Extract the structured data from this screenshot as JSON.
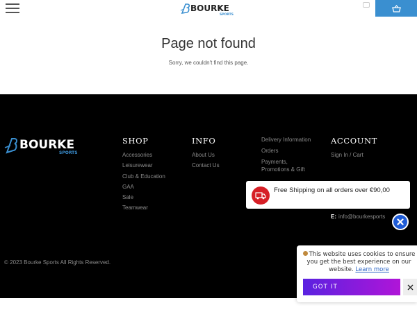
{
  "header": {
    "logo_alt": "BOURKE SPORTS",
    "menu_icon": "hamburger-icon",
    "basket_icon": "basket-icon"
  },
  "not_found": {
    "title": "Page not found",
    "message": "Sorry, we couldn't find this page."
  },
  "footer": {
    "brand": "BOURKE",
    "brand_sub": "SPORTS",
    "shop": {
      "heading": "SHOP",
      "links": [
        "Accessories",
        "Leisurewear",
        "Club & Education",
        "GAA",
        "Sale",
        "Teamwear"
      ]
    },
    "info": {
      "heading": "INFO",
      "links": [
        "About Us",
        "Contact Us"
      ]
    },
    "more": {
      "links": [
        "Delivery Information",
        "Orders",
        "Payments, Promotions & Gift"
      ]
    },
    "account": {
      "heading": "ACCOUNT",
      "links": [
        "Sign In / Cart"
      ]
    },
    "email_label": "E:",
    "email_value": "info@bourkesports",
    "copyright": "© 2023 Bourke Sports All Rights Reserved."
  },
  "shipping_popup": {
    "text": "Free Shipping on all orders over €90,00",
    "icon": "truck-icon",
    "close_icon": "close-icon"
  },
  "cookie_banner": {
    "text": "This website uses cookies to ensure you get the best experience on our website.",
    "learn_more": "Learn more",
    "button": "GOT IT",
    "close_icon": "close-icon"
  },
  "colors": {
    "accent_blue": "#3a8fd0",
    "footer_bg": "#000000",
    "truck_red": "#d61f26",
    "close_blue": "#1e5bd6",
    "gotit_start": "#5a22e0",
    "gotit_end": "#b015d8"
  }
}
